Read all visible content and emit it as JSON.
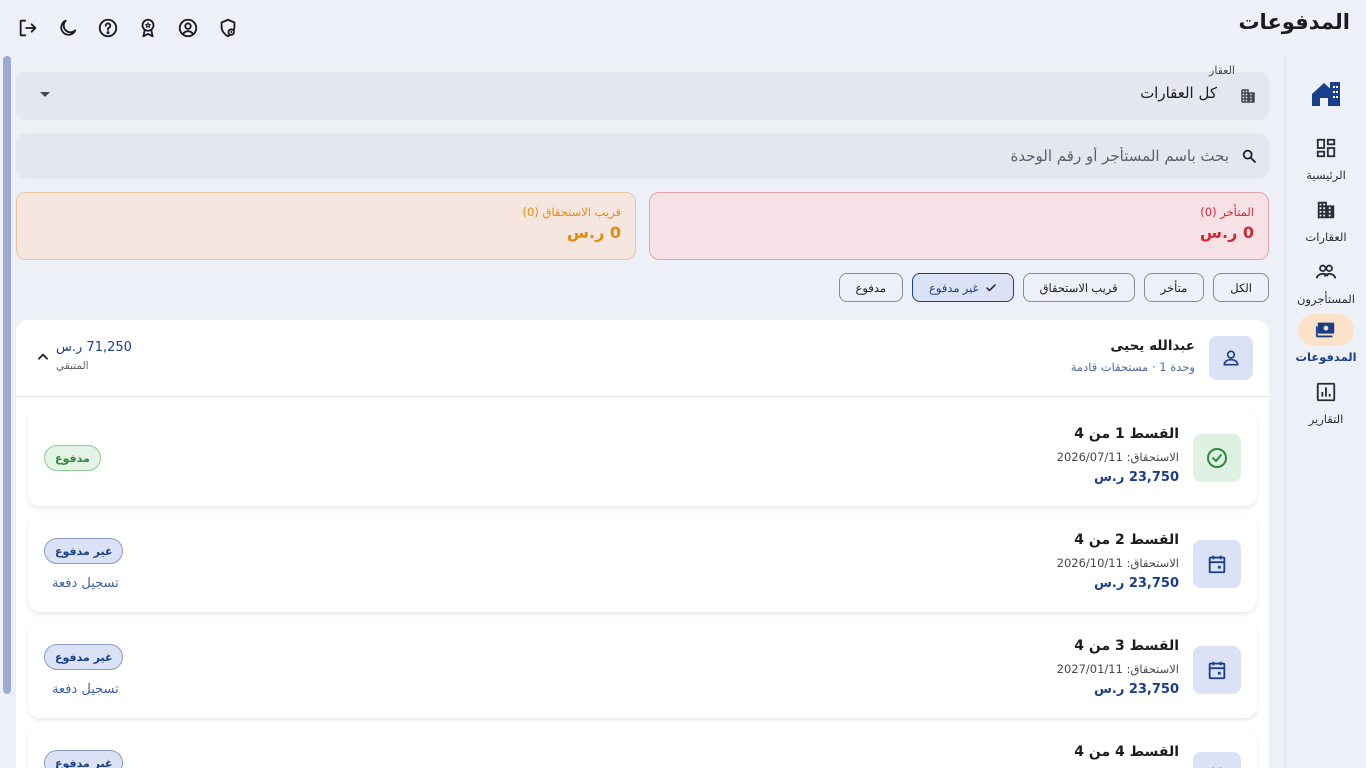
{
  "header": {
    "title": "المدفوعات"
  },
  "top_icons": [
    "logout-icon",
    "dark-mode-icon",
    "help-icon",
    "award-icon",
    "account-icon",
    "notification-settings-icon"
  ],
  "nav": {
    "items": [
      {
        "label": "الرئيسية",
        "icon": "dashboard-icon"
      },
      {
        "label": "العقارات",
        "icon": "building-icon"
      },
      {
        "label": "المستأجرون",
        "icon": "people-icon"
      },
      {
        "label": "المدفوعات",
        "icon": "payments-icon",
        "active": true
      },
      {
        "label": "التقارير",
        "icon": "reports-icon"
      }
    ]
  },
  "filters": {
    "property_label": "العقار",
    "property_value": "كل العقارات",
    "search_placeholder": "بحث باسم المستأجر أو رقم الوحدة"
  },
  "summary": {
    "overdue": {
      "label": "المتأخر (0)",
      "value": "0 ر.س"
    },
    "near_due": {
      "label": "قريب الاستحقاق (0)",
      "value": "0 ر.س"
    }
  },
  "chips": [
    {
      "label": "الكل"
    },
    {
      "label": "متأخر"
    },
    {
      "label": "قريب الاستحقاق"
    },
    {
      "label": "غير مدفوع",
      "selected": true
    },
    {
      "label": "مدفوع"
    }
  ],
  "tenant": {
    "name": "عبدالله يحيى",
    "subtitle": "وحدة 1 · مستحقات قادمة",
    "remaining_amount": "71,250 ر.س",
    "remaining_label": "المتبقي"
  },
  "installments": [
    {
      "title": "القسط 1 من 4",
      "due": "الاستحقاق: 2026/07/11",
      "amount": "23,750 ر.س",
      "status": "مدفوع"
    },
    {
      "title": "القسط 2 من 4",
      "due": "الاستحقاق: 2026/10/11",
      "amount": "23,750 ر.س",
      "status": "غير مدفوع",
      "action": "تسجيل دفعة"
    },
    {
      "title": "القسط 3 من 4",
      "due": "الاستحقاق: 2027/01/11",
      "amount": "23,750 ر.س",
      "status": "غير مدفوع",
      "action": "تسجيل دفعة"
    },
    {
      "title": "القسط 4 من 4",
      "status": "غير مدفوع"
    }
  ],
  "colors": {
    "primary": "#1a3f8a",
    "overdue": "#d02a35",
    "near_due": "#e58b10",
    "paid": "#2f8a3e",
    "background": "#eef0f8"
  }
}
